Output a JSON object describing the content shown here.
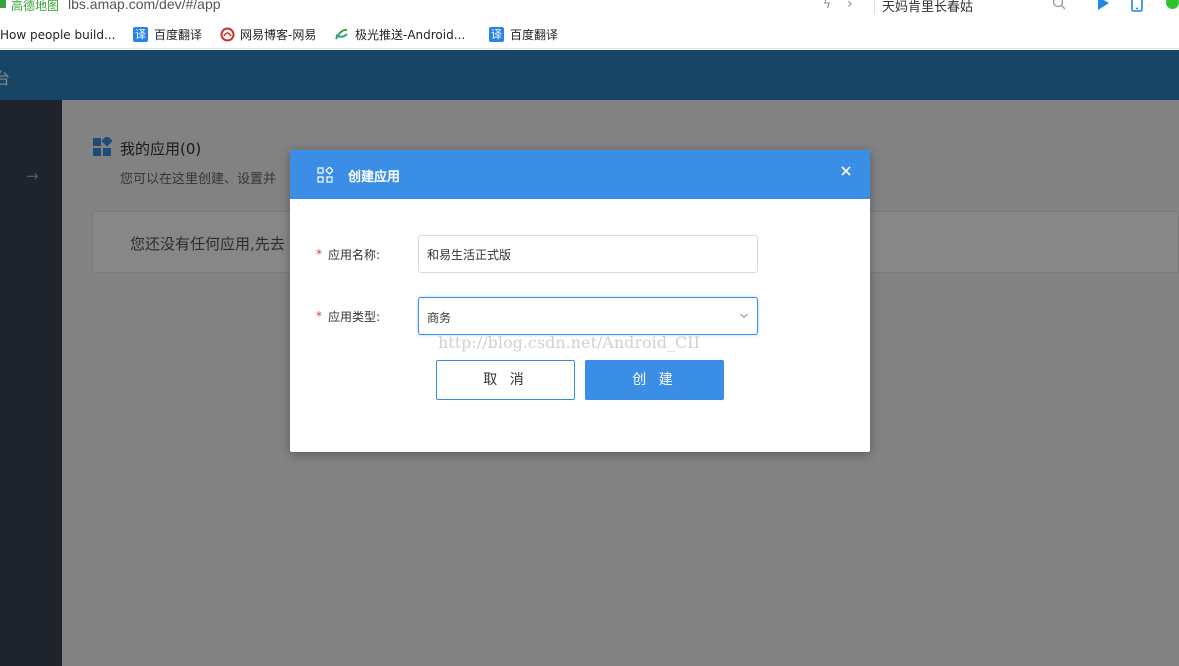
{
  "browser": {
    "site_label": "高德地图",
    "url": "lbs.amap.com/dev/#/app",
    "search_text": "天妈肯里长春姑",
    "bookmarks": [
      {
        "label": "How people build...",
        "icon": "github-icon"
      },
      {
        "label": "百度翻译",
        "icon": "baidu-translate-icon"
      },
      {
        "label": "网易博客-网易",
        "icon": "netease-blog-icon"
      },
      {
        "label": "极光推送-Android...",
        "icon": "jpush-icon"
      },
      {
        "label": "百度翻译",
        "icon": "baidu-translate-icon"
      }
    ],
    "translate_icon_glyph": "译"
  },
  "app": {
    "header_text": "台",
    "page_title": "我的应用(0)",
    "page_subtitle": "您可以在这里创建、设置并",
    "empty_text": "您还没有任何应用,先去"
  },
  "modal": {
    "title": "创建应用",
    "required_mark": "*",
    "name_label": "应用名称:",
    "name_value": "和易生活正式版",
    "type_label": "应用类型:",
    "type_value": "商务",
    "cancel_label": "取 消",
    "create_label": "创 建"
  },
  "watermark": "http://blog.csdn.net/Android_CII",
  "colors": {
    "primary": "#3a8ee6",
    "header": "#2a82c0",
    "sidebar": "#3c4553",
    "required": "#e53935"
  }
}
